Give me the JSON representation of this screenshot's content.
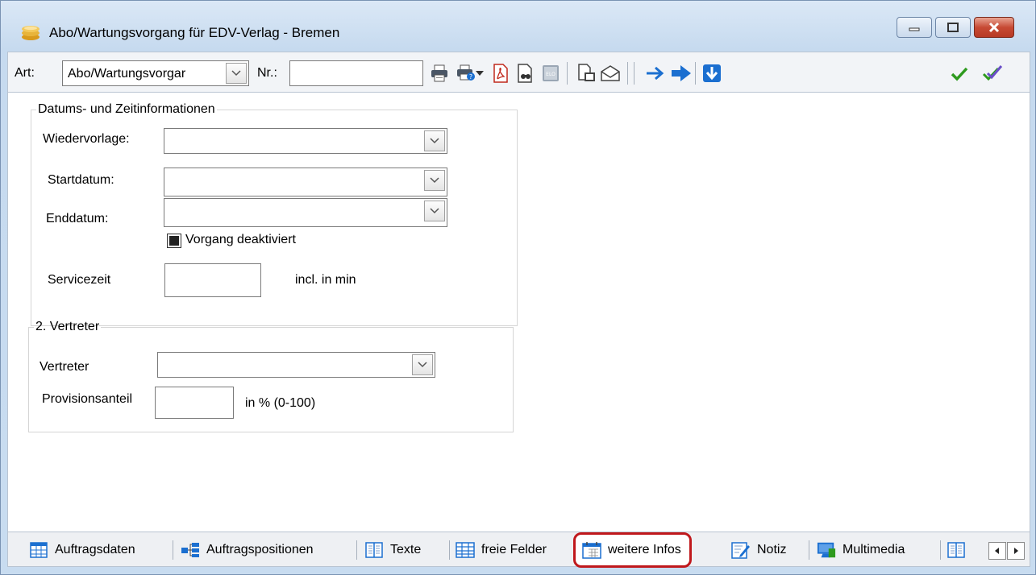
{
  "window": {
    "title": "Abo/Wartungsvorgang für EDV-Verlag - Bremen",
    "icon": "coins-stack-icon"
  },
  "toolbar": {
    "art_label": "Art:",
    "art_value": "Abo/Wartungsvorgar",
    "nr_label": "Nr.:",
    "nr_value": "",
    "icons": [
      "printer-icon",
      "printer-options-icon",
      "chevron-down-icon",
      "pdf-icon",
      "document-search-icon",
      "elo-icon",
      "copy-document-icon",
      "envelope-icon",
      "arrow-right-icon",
      "arrow-right-bold-icon",
      "arrow-down-box-icon",
      "check-icon",
      "double-check-icon"
    ]
  },
  "datums_group": {
    "legend": "Datums- und Zeitinformationen",
    "wiedervorlage_label": "Wiedervorlage:",
    "wiedervorlage_value": "",
    "startdatum_label": "Startdatum:",
    "startdatum_value": "",
    "enddatum_label": "Enddatum:",
    "enddatum_value": "",
    "deaktiviert_label": "Vorgang deaktiviert",
    "servicezeit_label": "Servicezeit",
    "servicezeit_value": "",
    "servicezeit_unit": "incl. in min"
  },
  "vertreter_group": {
    "legend": "2. Vertreter",
    "vertreter_label": "Vertreter",
    "vertreter_value": "",
    "provision_label": "Provisionsanteil",
    "provision_value": "",
    "provision_unit": "in % (0-100)"
  },
  "tabs": [
    {
      "label": "Auftragsdaten",
      "icon": "table-icon"
    },
    {
      "label": "Auftragspositionen",
      "icon": "hierarchy-icon"
    },
    {
      "label": "Texte",
      "icon": "columns-icon"
    },
    {
      "label": "freie Felder",
      "icon": "grid-icon"
    },
    {
      "label": "weitere Infos",
      "icon": "calendar-icon",
      "active": true
    },
    {
      "label": "Notiz",
      "icon": "note-edit-icon"
    },
    {
      "label": "Multimedia",
      "icon": "monitor-icon"
    },
    {
      "label": "",
      "icon": "columns-icon"
    }
  ],
  "colors": {
    "highlight": "#c0181c",
    "accent_blue": "#1b6fd0",
    "check_green": "#2e9a1e"
  }
}
